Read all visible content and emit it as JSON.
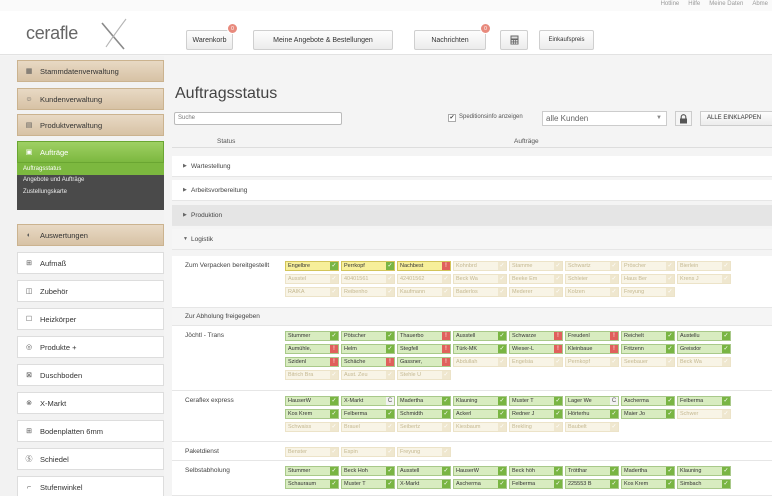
{
  "toplinks": [
    "Hotline",
    "Hilfe",
    "Meine Daten",
    "Abme"
  ],
  "logo": "cerafle",
  "nav": [
    {
      "label": "Warenkorb",
      "badge": "0"
    },
    {
      "label": "Meine Angebote & Bestellungen"
    },
    {
      "label": "Nachrichten",
      "badge": "0"
    },
    {
      "label": "",
      "icon": "calculator-icon"
    },
    {
      "label": "Einkaufspreis"
    }
  ],
  "sidebar": {
    "items": [
      {
        "label": "Stammdatenverwaltung",
        "icon": "building-icon"
      },
      {
        "label": "Kundenverwaltung",
        "icon": "users-icon"
      },
      {
        "label": "Produktverwaltung",
        "icon": "folder-icon"
      },
      {
        "label": "Aufträge",
        "icon": "list-icon"
      },
      {
        "label": "Auswertungen",
        "icon": "chart-icon"
      },
      {
        "label": "Aufmaß",
        "icon": "grid-icon"
      },
      {
        "label": "Zubehör",
        "icon": "box-icon"
      },
      {
        "label": "Heizkörper",
        "icon": "heater-icon"
      },
      {
        "label": "Produkte +",
        "icon": "product-icon"
      },
      {
        "label": "Duschboden",
        "icon": "shower-icon"
      },
      {
        "label": "X-Markt",
        "icon": "x-icon"
      },
      {
        "label": "Bodenplatten 6mm",
        "icon": "tiles-icon"
      },
      {
        "label": "Schiedel",
        "icon": "s-icon"
      },
      {
        "label": "Stufenwinkel",
        "icon": "step-icon"
      }
    ],
    "submenu": [
      "Auftragsstatus",
      "Angebote und Aufträge",
      "Zustellungskarte"
    ]
  },
  "main": {
    "title": "Auftragsstatus",
    "search_placeholder": "Suche",
    "checkbox_label": "Speditionsinfo anzeigen",
    "checkbox_mark": "✔",
    "select_value": "alle Kunden",
    "collapse_label": "ALLE EINKLAPPEN",
    "col_status": "Status",
    "col_orders": "Aufträge",
    "groups": [
      {
        "label": "Wartestellung",
        "open": false
      },
      {
        "label": "Arbeitsvorbereitung",
        "open": false
      },
      {
        "label": "Produktion",
        "open": false
      },
      {
        "label": "Logistik",
        "open": true
      }
    ],
    "sections": {
      "verpacken": {
        "label": "Zum Verpacken bereitgestellt",
        "rows": [
          [
            [
              "Engelbre",
              "Y",
              "✓"
            ],
            [
              "Perrkopf",
              "Y",
              "✓"
            ],
            [
              "Nachbest",
              "Y",
              "!"
            ],
            [
              "Kohnbrd",
              "F",
              "✓"
            ],
            [
              "Stamme",
              "F",
              "✓"
            ],
            [
              "Schwartz",
              "F",
              "✓"
            ],
            [
              "Pröscher",
              "F",
              "✓"
            ],
            [
              "Bierlein",
              "F",
              "✓"
            ]
          ],
          [
            [
              "Ausstel",
              "F",
              "✓"
            ],
            [
              "40401561",
              "F",
              "✓"
            ],
            [
              "42401562",
              "F",
              "✓"
            ],
            [
              "Beck Wa",
              "F",
              "✓"
            ],
            [
              "Beeke Em",
              "F",
              "✓"
            ],
            [
              "Schleier",
              "F",
              "✓"
            ],
            [
              "Haus Ber",
              "F",
              "✓"
            ],
            [
              "Krens J",
              "F",
              "✓"
            ]
          ],
          [
            [
              "RAIKA",
              "F",
              "✓"
            ],
            [
              "Reibenho",
              "F",
              "✓"
            ],
            [
              "Kaufmann",
              "F",
              "✓"
            ],
            [
              "Baderlos",
              "F",
              "✓"
            ],
            [
              "Mederer",
              "F",
              "✓"
            ],
            [
              "Kolzen",
              "F",
              "✓"
            ],
            [
              "Freyung",
              "F",
              "✓"
            ]
          ]
        ]
      },
      "abholung": {
        "label": "Zur Abholung freigegeben"
      },
      "jochtl": {
        "label": "Jöchtl - Trans",
        "rows": [
          [
            [
              "Stummer",
              "G",
              "✓"
            ],
            [
              "Pötscher",
              "G",
              "✓"
            ],
            [
              "Thauerbo",
              "G",
              "!"
            ],
            [
              "Ausstell",
              "G",
              "✓"
            ],
            [
              "Schwarze",
              "G",
              "!"
            ],
            [
              "Freudenl",
              "G",
              "!"
            ],
            [
              "Reichelt",
              "G",
              "✓"
            ],
            [
              "Austellu",
              "G",
              "✓"
            ]
          ],
          [
            [
              "Aumühle,",
              "G",
              "!"
            ],
            [
              "Helm",
              "G",
              "✓"
            ],
            [
              "Stegfell",
              "G",
              "!"
            ],
            [
              "Türk-MK",
              "G",
              "✓"
            ],
            [
              "Wieser-L",
              "G",
              "!"
            ],
            [
              "Kleinbaue",
              "G",
              "!"
            ],
            [
              "Fritzenn",
              "G",
              "✓"
            ],
            [
              "Greisdor",
              "G",
              "✓"
            ]
          ],
          [
            [
              "Szidenl",
              "G",
              "!"
            ],
            [
              "Schäche",
              "G",
              "!"
            ],
            [
              "Gassner,",
              "G",
              "!"
            ],
            [
              "Abdullah",
              "F",
              "✓"
            ],
            [
              "Engelsia",
              "F",
              "✓"
            ],
            [
              "Pernkopf",
              "F",
              "✓"
            ],
            [
              "Seebauer",
              "F",
              "✓"
            ],
            [
              "Beck Wa",
              "F",
              "✓"
            ]
          ],
          [
            [
              "Bitrich Bra",
              "F",
              "✓"
            ],
            [
              "Aust. Zeu",
              "F",
              "✓"
            ],
            [
              "Stehle U",
              "F",
              "✓"
            ]
          ]
        ]
      },
      "express": {
        "label": "Ceraflex express",
        "rows": [
          [
            [
              "HauserW",
              "G",
              "✓"
            ],
            [
              "X-Markt",
              "G",
              "C"
            ],
            [
              "Madertha",
              "G",
              "✓"
            ],
            [
              "Klauning",
              "G",
              "✓"
            ],
            [
              "Muster T",
              "G",
              "✓"
            ],
            [
              "Lager We",
              "G",
              "C"
            ],
            [
              "Ascherma",
              "G",
              "✓"
            ],
            [
              "Felberma",
              "G",
              "✓"
            ]
          ],
          [
            [
              "Kos Krem",
              "G",
              "✓"
            ],
            [
              "Felberma",
              "G",
              "✓"
            ],
            [
              "Schmidth",
              "G",
              "✓"
            ],
            [
              "Ackerl",
              "G",
              "✓"
            ],
            [
              "Redner J",
              "G",
              "✓"
            ],
            [
              "Hörterhu",
              "G",
              "✓"
            ],
            [
              "Maier Jo",
              "G",
              "✓"
            ],
            [
              "Schwer",
              "F",
              "✓"
            ]
          ],
          [
            [
              "Schwaiss",
              "F",
              "✓"
            ],
            [
              "Brauel",
              "F",
              "✓"
            ],
            [
              "Seibertz",
              "F",
              "✓"
            ],
            [
              "Kiesbaum",
              "F",
              "✓"
            ],
            [
              "Brekling",
              "F",
              "✓"
            ],
            [
              "Baubelt",
              "F",
              "✓"
            ]
          ]
        ]
      },
      "paket": {
        "label": "Paketdienst",
        "rows": [
          [
            [
              "Benster",
              "F",
              "✓"
            ],
            [
              "Espin",
              "F",
              "✓"
            ],
            [
              "Freyung",
              "F",
              "✓"
            ]
          ]
        ]
      },
      "selbst": {
        "label": "Selbstabholung",
        "rows": [
          [
            [
              "Stummer",
              "G",
              "✓"
            ],
            [
              "Beck Hoh",
              "G",
              "✓"
            ],
            [
              "Ausstell",
              "G",
              "✓"
            ],
            [
              "HauserW",
              "G",
              "✓"
            ],
            [
              "Beck höh",
              "G",
              "✓"
            ],
            [
              "Trötthar",
              "G",
              "✓"
            ],
            [
              "Madertha",
              "G",
              "✓"
            ],
            [
              "Klauning",
              "G",
              "✓"
            ]
          ],
          [
            [
              "Schauraum",
              "G",
              "✓"
            ],
            [
              "Muster T",
              "G",
              "✓"
            ],
            [
              "X-Markt",
              "G",
              "✓"
            ],
            [
              "Ascherma",
              "G",
              "✓"
            ],
            [
              "Felberma",
              "G",
              "✓"
            ],
            [
              "225553 B",
              "G",
              "✓"
            ],
            [
              "Kos Krem",
              "G",
              "✓"
            ],
            [
              "Simbach",
              "G",
              "✓"
            ]
          ]
        ]
      }
    }
  }
}
